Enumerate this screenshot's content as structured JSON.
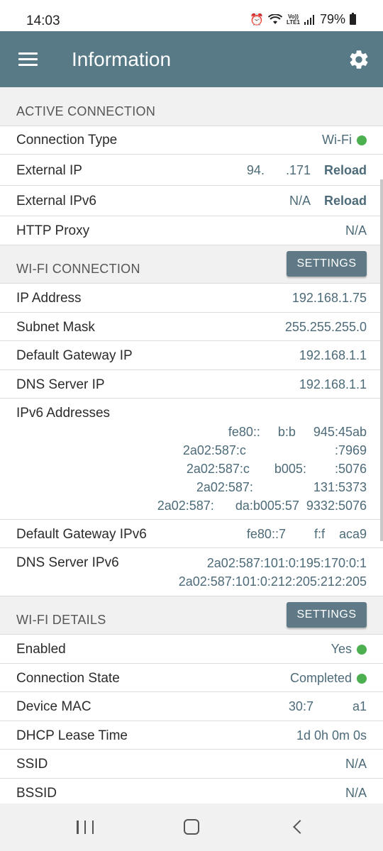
{
  "status_bar": {
    "time": "14:03",
    "volte_top": "Vo))",
    "volte_bottom": "LTE1",
    "battery": "79%"
  },
  "app_bar": {
    "title": "Information",
    "menu_icon": "hamburger-menu-icon",
    "settings_icon": "gear-icon",
    "background": "#587a87"
  },
  "active_connection": {
    "title": "ACTIVE CONNECTION",
    "rows": [
      {
        "label": "Connection Type",
        "value": "Wi-Fi",
        "status_dot": true
      },
      {
        "label": "External IP",
        "value": "94.      .171",
        "action": "Reload"
      },
      {
        "label": "External IPv6",
        "value": "N/A",
        "action": "Reload"
      },
      {
        "label": "HTTP Proxy",
        "value": "N/A"
      }
    ]
  },
  "wifi_connection": {
    "title": "WI-FI CONNECTION",
    "settings_label": "SETTINGS",
    "rows": [
      {
        "label": "IP Address",
        "value": "192.168.1.75"
      },
      {
        "label": "Subnet Mask",
        "value": "255.255.255.0"
      },
      {
        "label": "Default Gateway IP",
        "value": "192.168.1.1"
      },
      {
        "label": "DNS Server IP",
        "value": "192.168.1.1"
      }
    ],
    "ipv6_label": "IPv6 Addresses",
    "ipv6_values": [
      "fe80::     b:b     945:45ab",
      "2a02:587:c                         :7969",
      "2a02:587:c       b005:        :5076",
      "2a02:587:                 131:5373",
      "2a02:587:      da:b005:57  9332:5076"
    ],
    "gateway_v6_label": "Default Gateway IPv6",
    "gateway_v6_value": "fe80::7        f:f    aca9",
    "dns_v6_label": "DNS Server IPv6",
    "dns_v6_values": [
      "2a02:587:101:0:195:170:0:1",
      "2a02:587:101:0:212:205:212:205"
    ]
  },
  "wifi_details": {
    "title": "WI-FI DETAILS",
    "settings_label": "SETTINGS",
    "rows": [
      {
        "label": "Enabled",
        "value": "Yes",
        "status_dot": true
      },
      {
        "label": "Connection State",
        "value": "Completed",
        "status_dot": true
      },
      {
        "label": "Device MAC",
        "value": "30:7           a1"
      },
      {
        "label": "DHCP Lease Time",
        "value": "1d 0h 0m 0s"
      },
      {
        "label": "SSID",
        "value": "N/A"
      },
      {
        "label": "BSSID",
        "value": "N/A"
      }
    ]
  },
  "colors": {
    "accent": "#587a87",
    "value_text": "#4d6b78",
    "status_ok": "#4caf50",
    "section_bg": "#f1f1f1"
  },
  "nav_bar": {
    "recents_icon": "recents-icon",
    "home_icon": "home-icon",
    "back_icon": "back-icon"
  }
}
